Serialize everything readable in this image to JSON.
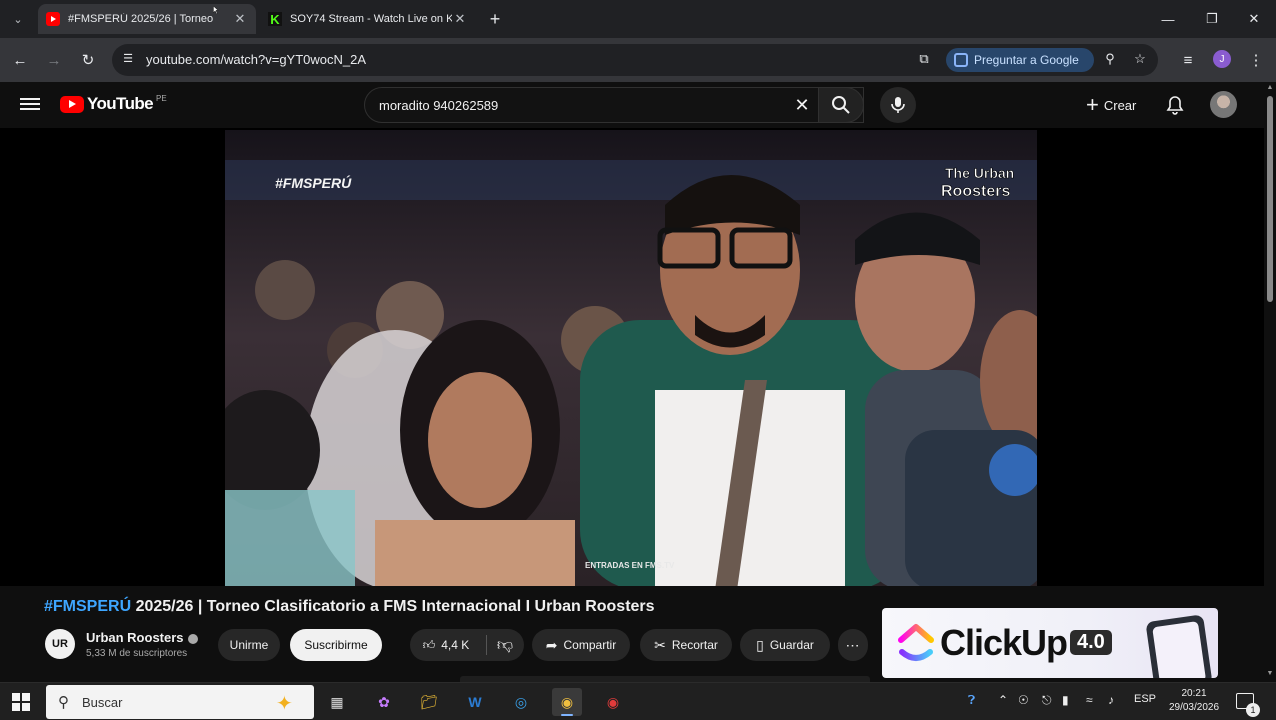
{
  "browser": {
    "tabs": [
      {
        "title": "#FMSPERÚ 2025/26 | Torneo",
        "active": true,
        "favicon": "youtube-icon"
      },
      {
        "title": "SOY74 Stream - Watch Live on K",
        "active": false,
        "favicon": "kick-icon"
      }
    ],
    "url": "youtube.com/watch?v=gYT0wocN_2A",
    "ask_google_label": "Preguntar a Google",
    "profile_initial": "J"
  },
  "youtube": {
    "logo_text": "YouTube",
    "country_code": "PE",
    "search_value": "moradito 940262589",
    "create_label": "Crear"
  },
  "video": {
    "title_hashtag": "#FMSPERÚ",
    "title_rest": " 2025/26 | Torneo Clasificatorio a FMS Internacional I Urban Roosters",
    "watermark_left": "#FMSPERÚ",
    "watermark_right_line1": "The Urban",
    "watermark_right_line2": "Roosters",
    "bottom_overlay": "ENTRADAS EN FMS.TV"
  },
  "channel": {
    "name": "Urban Roosters",
    "subscribers": "5,33 M de suscriptores",
    "avatar_text": "UR"
  },
  "actions": {
    "join": "Unirme",
    "subscribe": "Suscribirme",
    "likes": "4,4 K",
    "share": "Compartir",
    "clip": "Recortar",
    "save": "Guardar"
  },
  "ad": {
    "brand": "ClickUp",
    "version": "4.0"
  },
  "taskbar": {
    "search_placeholder": "Buscar",
    "language": "ESP",
    "time": "20:21",
    "date": "29/03/2026",
    "notification_count": "1"
  },
  "colors": {
    "youtube_red": "#ff0000",
    "link_blue": "#3ea6ff",
    "chrome_dark": "#202124",
    "chrome_toolbar": "#35363a"
  }
}
